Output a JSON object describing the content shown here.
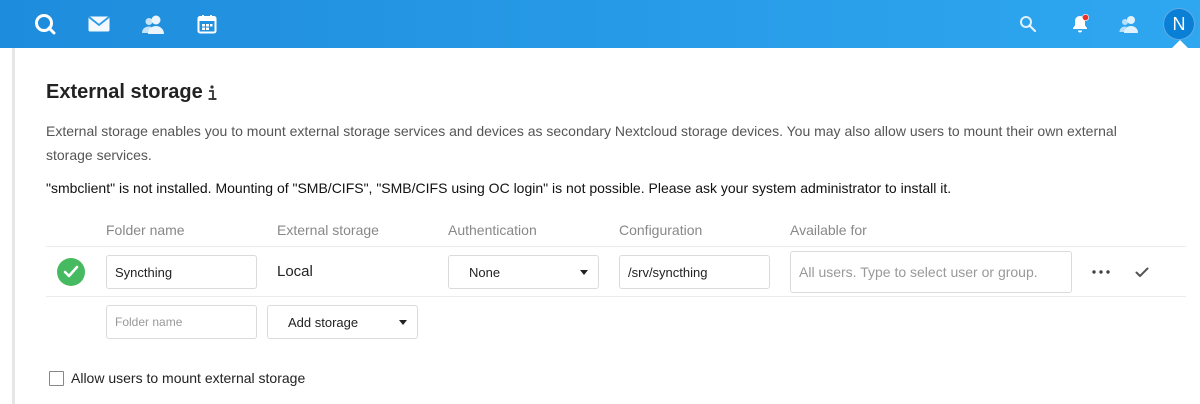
{
  "header": {
    "icons": [
      "nextcloud-logo-icon",
      "mail-icon",
      "contacts-icon",
      "calendar-icon"
    ],
    "right_icons": [
      "search-icon",
      "notifications-icon",
      "contacts-menu-icon"
    ],
    "avatar_initial": "N",
    "colors": {
      "bar": "#1e8cdc",
      "notification_dot": "#e9322d"
    }
  },
  "section": {
    "title": "External storage",
    "info_icon": "info-icon",
    "description": "External storage enables you to mount external storage services and devices as secondary Nextcloud storage devices. You may also allow users to mount their own external storage services.",
    "warning": "\"smbclient\" is not installed. Mounting of \"SMB/CIFS\", \"SMB/CIFS using OC login\" is not possible. Please ask your system administrator to install it."
  },
  "table": {
    "headers": {
      "folder_name": "Folder name",
      "external_storage": "External storage",
      "authentication": "Authentication",
      "configuration": "Configuration",
      "available_for": "Available for"
    },
    "rows": [
      {
        "status": "ok",
        "folder_name": "Syncthing",
        "external_storage": "Local",
        "authentication": "None",
        "configuration": "/srv/syncthing",
        "available_for_placeholder": "All users. Type to select user or group."
      }
    ],
    "new_row": {
      "folder_name_placeholder": "Folder name",
      "add_storage_label": "Add storage"
    },
    "colors": {
      "status_ok": "#46ba61"
    }
  },
  "options": {
    "allow_user_mounting_label": "Allow users to mount external storage",
    "allow_user_mounting_checked": false
  }
}
